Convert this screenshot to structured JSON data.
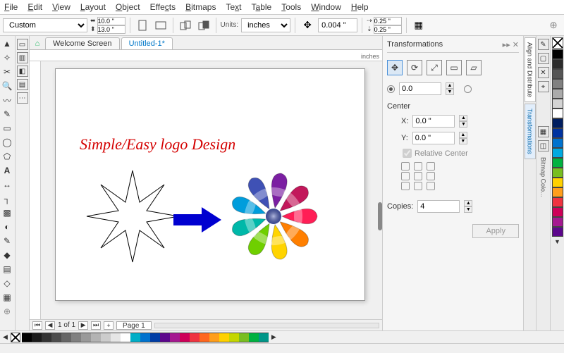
{
  "menu": [
    "File",
    "Edit",
    "View",
    "Layout",
    "Object",
    "Effects",
    "Bitmaps",
    "Text",
    "Table",
    "Tools",
    "Window",
    "Help"
  ],
  "propbar": {
    "preset": "Custom",
    "width": "10.0 \"",
    "height": "13.0 \"",
    "units_label": "Units:",
    "units_value": "inches",
    "nudge": "0.004 \"",
    "dupX": "0.25 \"",
    "dupY": "0.25 \""
  },
  "tabs": {
    "welcome": "Welcome Screen",
    "doc": "Untitled-1*"
  },
  "rulers": {
    "unit": "inches"
  },
  "canvas": {
    "headline": "Simple/Easy logo Design"
  },
  "pagenav": {
    "counter": "1 of 1",
    "plus": "+",
    "pagetab": "Page 1"
  },
  "panel": {
    "title": "Transformations",
    "angle": "0.0",
    "center_label": "Center",
    "cx": "0.0 \"",
    "cy": "0.0 \"",
    "x_label": "X:",
    "y_label": "Y:",
    "relative": "Relative Center",
    "copies_label": "Copies:",
    "copies_value": "4",
    "apply": "Apply"
  },
  "sidetabs": {
    "align": "Align and Distribute",
    "trans": "Transformations",
    "colors": "Bitmap Colo..."
  },
  "vpalette": [
    "#000000",
    "#2b2b2b",
    "#555555",
    "#808080",
    "#aaaaaa",
    "#d4d4d4",
    "#ffffff",
    "#001e60",
    "#0033a0",
    "#0072ce",
    "#00a9e0",
    "#00b140",
    "#78be20",
    "#ffd100",
    "#ff9e1b",
    "#ef3340",
    "#ce0058",
    "#a51890",
    "#5c068c"
  ],
  "hpalette": [
    "#000000",
    "#1a1a1a",
    "#333333",
    "#4d4d4d",
    "#666666",
    "#808080",
    "#999999",
    "#b3b3b3",
    "#cccccc",
    "#e6e6e6",
    "#ffffff",
    "#00aec7",
    "#0072ce",
    "#003da5",
    "#5c068c",
    "#a51890",
    "#ce0058",
    "#ef3340",
    "#ff671f",
    "#ff9e1b",
    "#ffd100",
    "#c4d600",
    "#78be20",
    "#00b140",
    "#009688"
  ],
  "logo_colors": [
    "#ff1e56",
    "#ff7f00",
    "#ffd400",
    "#6fcf00",
    "#00b8a9",
    "#009ddc",
    "#3f51b5",
    "#7b1fa2",
    "#c2185b"
  ],
  "logo_center": "#3f51b5"
}
